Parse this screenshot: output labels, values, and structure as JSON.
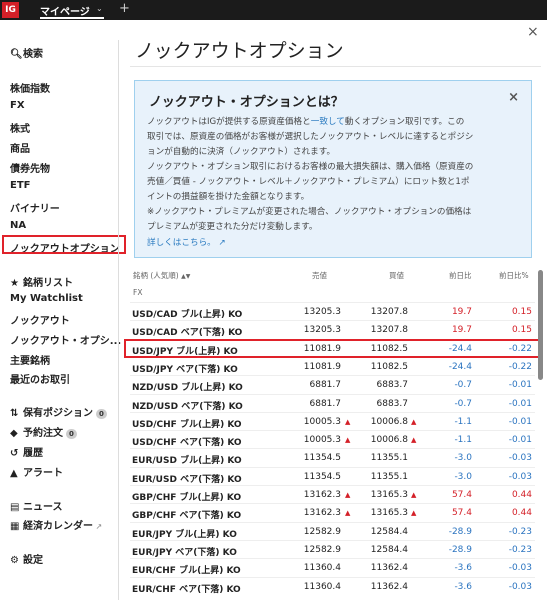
{
  "topbar": {
    "logo": "IG",
    "tab": "マイページ",
    "tab_chevron": "⌄",
    "plus": "+"
  },
  "sidebar": {
    "search": "検索",
    "markets": [
      "株価指数",
      "FX",
      "株式",
      "商品",
      "債券先物",
      "ETF",
      "バイナリー",
      "NA",
      "ノックアウトオプション"
    ],
    "lists": [
      "銘柄リスト",
      "My Watchlist",
      "ノックアウト",
      "ノックアウト・オプシ...",
      "主要銘柄",
      "最近のお取引"
    ],
    "positions": "保有ポジション",
    "positions_count": "0",
    "orders": "予約注文",
    "orders_count": "0",
    "history": "履歴",
    "alerts": "アラート",
    "news": "ニュース",
    "calendar": "経済カレンダー",
    "settings": "設定"
  },
  "page": {
    "title": "ノックアウトオプション",
    "close": "×"
  },
  "info": {
    "title": "ノックアウト・オプションとは？",
    "close": "×",
    "line1a": "ノックアウトはIGが提供する原資産価格と",
    "line1link": "一致して",
    "line1b": "動くオプション取引です。この",
    "line2": "取引では、原資産の価格がお客様が選択したノックアウト・レベルに達するとポジシ",
    "line3": "ョンが自動的に決済（ノックアウト）されます。",
    "line4": "ノックアウト・オプション取引におけるお客様の最大損失額は、購入価格（原資産の",
    "line5": "売値／買値 - ノックアウト・レベル＋ノックアウト・プレミアム）にロット数と1ポ",
    "line6": "イントの損益額を掛けた金額となります。",
    "line7": "※ノックアウト・プレミアムが変更された場合、ノックアウト・オプションの価格は",
    "line8": "プレミアムが変更された分だけ変動します。",
    "more": "詳しくはこちら。"
  },
  "table": {
    "headers": {
      "name": "銘柄 (人気順)",
      "sell": "売値",
      "buy": "買値",
      "chg": "前日比",
      "pct": "前日比%"
    },
    "group": "FX",
    "rows": [
      {
        "name": "USD/CAD ブル(上昇) KO",
        "sell": "13205.3",
        "buy": "13207.8",
        "chg": "19.7",
        "pct": "0.15",
        "up": true,
        "tri": false
      },
      {
        "name": "USD/CAD ベア(下落) KO",
        "sell": "13205.3",
        "buy": "13207.8",
        "chg": "19.7",
        "pct": "0.15",
        "up": true,
        "tri": false
      },
      {
        "name": "USD/JPY ブル(上昇) KO",
        "sell": "11081.9",
        "buy": "11082.5",
        "chg": "-24.4",
        "pct": "-0.22",
        "up": false,
        "tri": false
      },
      {
        "name": "USD/JPY ベア(下落) KO",
        "sell": "11081.9",
        "buy": "11082.5",
        "chg": "-24.4",
        "pct": "-0.22",
        "up": false,
        "tri": false
      },
      {
        "name": "NZD/USD ブル(上昇) KO",
        "sell": "6881.7",
        "buy": "6883.7",
        "chg": "-0.7",
        "pct": "-0.01",
        "up": false,
        "tri": false
      },
      {
        "name": "NZD/USD ベア(下落) KO",
        "sell": "6881.7",
        "buy": "6883.7",
        "chg": "-0.7",
        "pct": "-0.01",
        "up": false,
        "tri": false
      },
      {
        "name": "USD/CHF ブル(上昇) KO",
        "sell": "10005.3",
        "buy": "10006.8",
        "chg": "-1.1",
        "pct": "-0.01",
        "up": false,
        "tri": true
      },
      {
        "name": "USD/CHF ベア(下落) KO",
        "sell": "10005.3",
        "buy": "10006.8",
        "chg": "-1.1",
        "pct": "-0.01",
        "up": false,
        "tri": true
      },
      {
        "name": "EUR/USD ブル(上昇) KO",
        "sell": "11354.5",
        "buy": "11355.1",
        "chg": "-3.0",
        "pct": "-0.03",
        "up": false,
        "tri": false
      },
      {
        "name": "EUR/USD ベア(下落) KO",
        "sell": "11354.5",
        "buy": "11355.1",
        "chg": "-3.0",
        "pct": "-0.03",
        "up": false,
        "tri": false
      },
      {
        "name": "GBP/CHF ブル(上昇) KO",
        "sell": "13162.3",
        "buy": "13165.3",
        "chg": "57.4",
        "pct": "0.44",
        "up": true,
        "tri": true
      },
      {
        "name": "GBP/CHF ベア(下落) KO",
        "sell": "13162.3",
        "buy": "13165.3",
        "chg": "57.4",
        "pct": "0.44",
        "up": true,
        "tri": true
      },
      {
        "name": "EUR/JPY ブル(上昇) KO",
        "sell": "12582.9",
        "buy": "12584.4",
        "chg": "-28.9",
        "pct": "-0.23",
        "up": false,
        "tri": false
      },
      {
        "name": "EUR/JPY ベア(下落) KO",
        "sell": "12582.9",
        "buy": "12584.4",
        "chg": "-28.9",
        "pct": "-0.23",
        "up": false,
        "tri": false
      },
      {
        "name": "EUR/CHF ブル(上昇) KO",
        "sell": "11360.4",
        "buy": "11362.4",
        "chg": "-3.6",
        "pct": "-0.03",
        "up": false,
        "tri": false
      },
      {
        "name": "EUR/CHF ベア(下落) KO",
        "sell": "11360.4",
        "buy": "11362.4",
        "chg": "-3.6",
        "pct": "-0.03",
        "up": false,
        "tri": false
      }
    ]
  },
  "colors": {
    "up": "#d42028",
    "down": "#2b74c0",
    "highlight": "#e0222a",
    "brand": "#d42028"
  }
}
